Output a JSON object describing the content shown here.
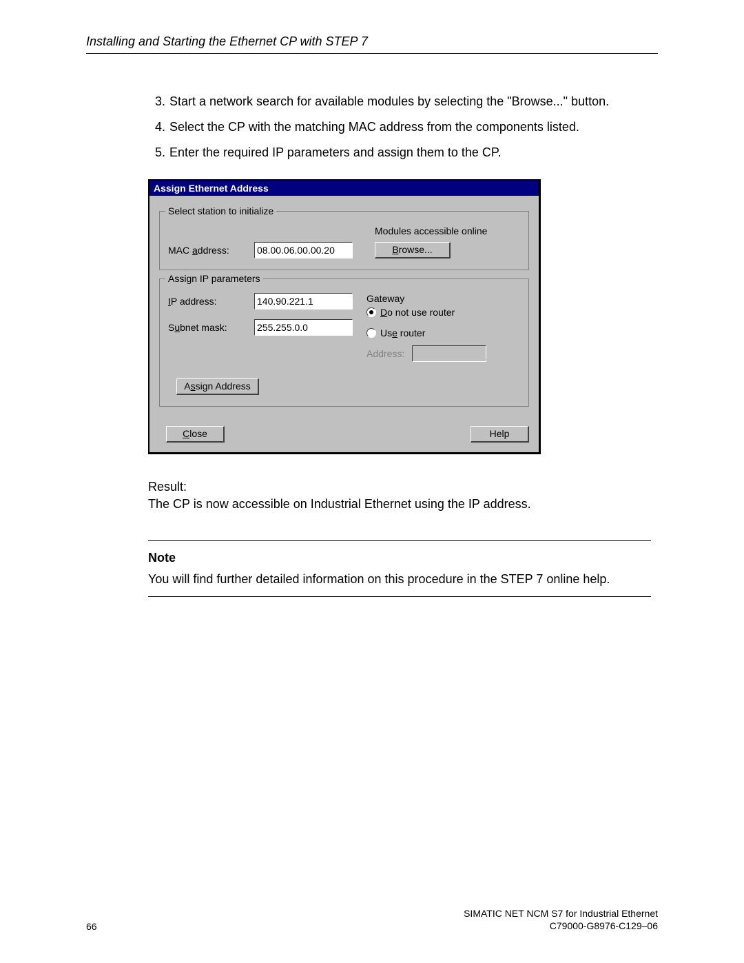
{
  "header": {
    "title": "Installing and Starting the Ethernet CP with STEP 7"
  },
  "steps": [
    {
      "num": "3.",
      "text": "Start a network search for available modules by selecting the \"Browse...\" button."
    },
    {
      "num": "4.",
      "text": "Select the CP with the matching MAC address from the components listed."
    },
    {
      "num": "5.",
      "text": "Enter the required IP parameters and assign them to the CP."
    }
  ],
  "dialog": {
    "title": "Assign Ethernet Address",
    "group1": {
      "legend": "Select station to initialize",
      "modules_label": "Modules accessible online",
      "mac_label_prefix": "MAC ",
      "mac_label_u": "a",
      "mac_label_suffix": "ddress:",
      "mac_value": "08.00.06.00.00.20",
      "browse_u": "B",
      "browse_suffix": "rowse..."
    },
    "group2": {
      "legend": "Assign IP parameters",
      "ip_u": "I",
      "ip_label_suffix": "P address:",
      "ip_value": "140.90.221.1",
      "subnet_prefix": "S",
      "subnet_u": "u",
      "subnet_suffix": "bnet mask:",
      "subnet_value": "255.255.0.0",
      "gateway_label": "Gateway",
      "radio1_u": "D",
      "radio1_suffix": "o not use router",
      "radio2_prefix": "Us",
      "radio2_u": "e",
      "radio2_suffix": " router",
      "address_label": "Address:",
      "assign_prefix": "A",
      "assign_u": "s",
      "assign_suffix": "sign Address"
    },
    "close_u": "C",
    "close_suffix": "lose",
    "help": "Help"
  },
  "result": {
    "heading": "Result:",
    "text": "The CP is now accessible on Industrial Ethernet using the IP address."
  },
  "note": {
    "title": "Note",
    "text": "You will find further detailed information on this procedure in the STEP 7 online help."
  },
  "footer": {
    "page": "66",
    "line1": "SIMATIC NET NCM S7 for Industrial Ethernet",
    "line2": "C79000-G8976-C129–06"
  }
}
